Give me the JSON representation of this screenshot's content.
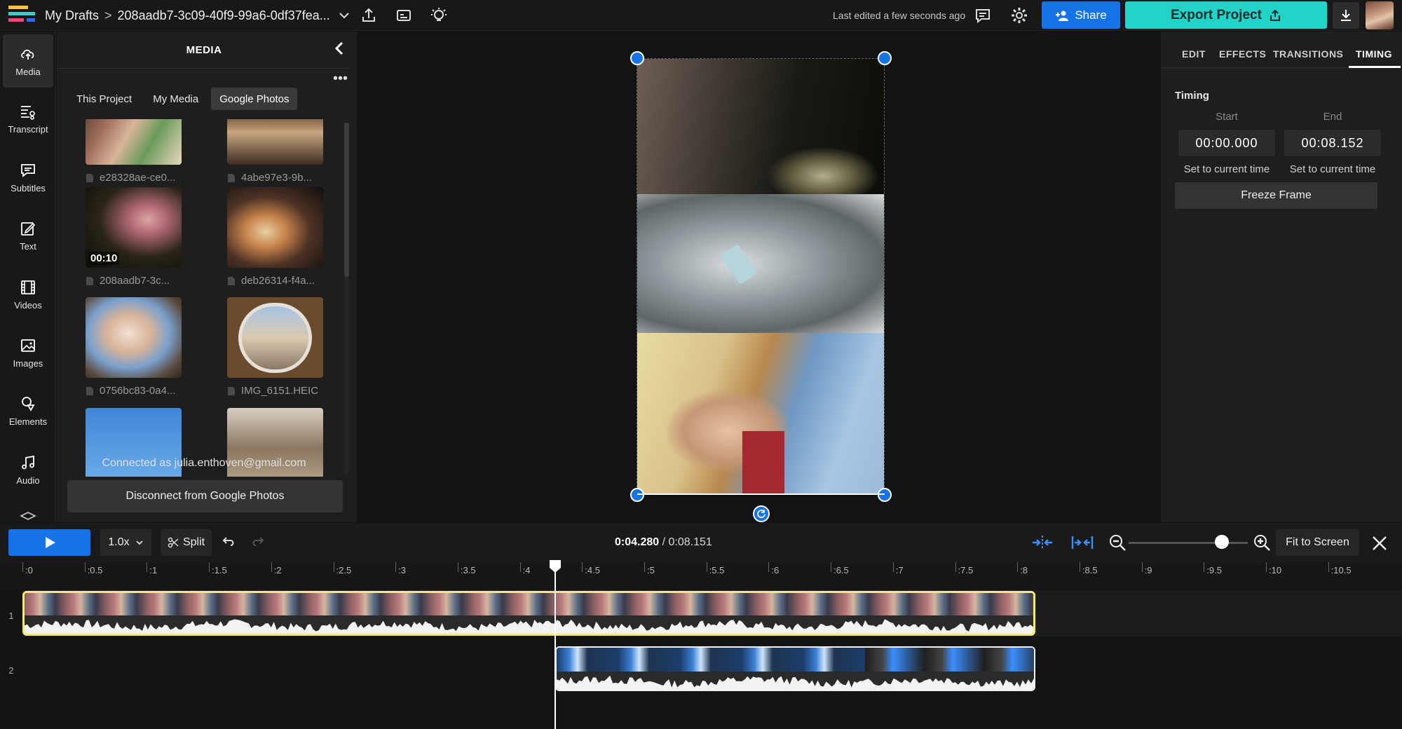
{
  "header": {
    "breadcrumb_root": "My Drafts",
    "breadcrumb_sep": ">",
    "project_title": "208aadb7-3c09-40f9-99a6-0df37fea...",
    "last_edited": "Last edited a few seconds ago",
    "share_label": "Share",
    "export_label": "Export Project"
  },
  "rail": {
    "items": [
      {
        "label": "Media",
        "icon": "upload-cloud-icon"
      },
      {
        "label": "Transcript",
        "icon": "transcript-icon"
      },
      {
        "label": "Subtitles",
        "icon": "subtitles-icon"
      },
      {
        "label": "Text",
        "icon": "text-edit-icon"
      },
      {
        "label": "Videos",
        "icon": "film-icon"
      },
      {
        "label": "Images",
        "icon": "image-icon"
      },
      {
        "label": "Elements",
        "icon": "shapes-icon"
      },
      {
        "label": "Audio",
        "icon": "music-note-icon"
      }
    ]
  },
  "media": {
    "title": "MEDIA",
    "tabs": [
      "This Project",
      "My Media",
      "Google Photos"
    ],
    "active_tab": "Google Photos",
    "items": [
      {
        "name": "e28328ae-ce0...",
        "duration": ""
      },
      {
        "name": "4abe97e3-9b...",
        "duration": ""
      },
      {
        "name": "208aadb7-3c...",
        "duration": "00:10"
      },
      {
        "name": "deb26314-f4a...",
        "duration": ""
      },
      {
        "name": "0756bc83-0a4...",
        "duration": ""
      },
      {
        "name": "IMG_6151.HEIC",
        "duration": ""
      }
    ],
    "connected_as": "Connected as julia.enthoven@gmail.com",
    "disconnect_label": "Disconnect from Google Photos"
  },
  "inspector": {
    "tabs": [
      "EDIT",
      "EFFECTS",
      "TRANSITIONS",
      "TIMING"
    ],
    "active_tab": "TIMING",
    "timing_title": "Timing",
    "start_label": "Start",
    "start_value": "00:00.000",
    "end_label": "End",
    "end_value": "00:08.152",
    "set_current_label": "Set to current time",
    "freeze_label": "Freeze Frame"
  },
  "timeline": {
    "speed": "1.0x",
    "split_label": "Split",
    "current_time": "0:04.280",
    "total_time": "/ 0:08.151",
    "fit_label": "Fit to Screen",
    "zoom_level": 0.78,
    "ruler_labels": [
      ":0",
      ":0.5",
      ":1",
      ":1.5",
      ":2",
      ":2.5",
      ":3",
      ":3.5",
      ":4",
      ":4.5",
      ":5",
      ":5.5",
      ":6",
      ":6.5",
      ":7",
      ":7.5",
      ":8",
      ":8.5",
      ":9",
      ":9.5",
      ":10",
      ":10.5"
    ],
    "tracks": [
      "1",
      "2"
    ]
  },
  "colors": {
    "accent": "#1473e6",
    "export": "#22d3c8",
    "clip_selected": "#f3e87a"
  }
}
